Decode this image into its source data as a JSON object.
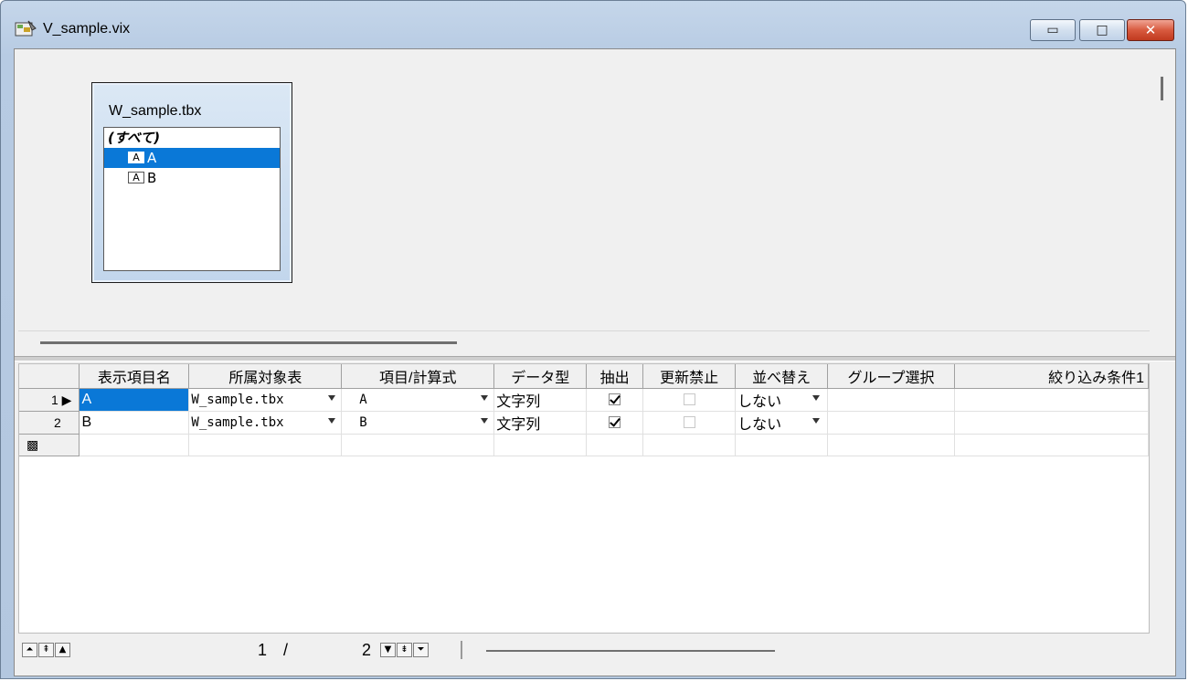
{
  "window": {
    "title": "V_sample.vix",
    "minimize_glyph": "▭",
    "maximize_glyph": "□",
    "close_glyph": "✕"
  },
  "table_box": {
    "title": "W_sample.tbx",
    "all_label": "(すべて)",
    "fields": [
      {
        "icon": "A",
        "name": "A",
        "selected": true
      },
      {
        "icon": "A",
        "name": "B",
        "selected": false
      }
    ]
  },
  "grid": {
    "columns": [
      "表示項目名",
      "所属対象表",
      "項目/計算式",
      "データ型",
      "抽出",
      "更新禁止",
      "並べ替え",
      "グループ選択",
      "絞り込み条件1"
    ],
    "rows": [
      {
        "num": "1",
        "marker": "▶",
        "name": "A",
        "table": "W_sample.tbx",
        "expr": "A",
        "type": "文字列",
        "extract": true,
        "nochange": false,
        "sort": "しない"
      },
      {
        "num": "2",
        "marker": "",
        "name": "B",
        "table": "W_sample.tbx",
        "expr": "B",
        "type": "文字列",
        "extract": true,
        "nochange": false,
        "sort": "しない"
      }
    ],
    "new_row_marker": "▩"
  },
  "navigator": {
    "current": "1",
    "separator": "/",
    "total": "2"
  }
}
